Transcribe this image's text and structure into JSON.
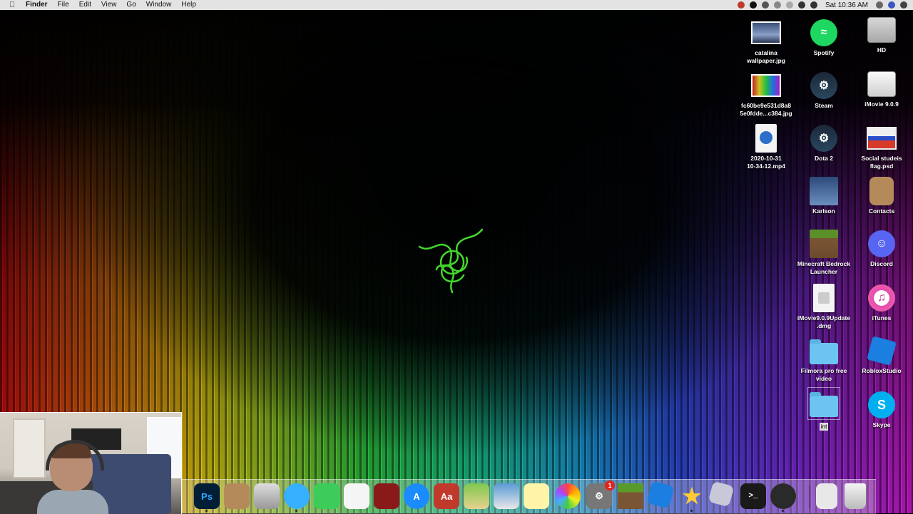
{
  "menubar": {
    "app_name": "Finder",
    "menus": [
      "File",
      "Edit",
      "View",
      "Go",
      "Window",
      "Help"
    ],
    "clock": "Sat 10:36 AM"
  },
  "desktop": {
    "icons": [
      {
        "label": "catalina\nwallpaper.jpg",
        "kind": "image-file"
      },
      {
        "label": "fc60be9e531d8a8\n5e0fdde...c384.jpg",
        "kind": "image-file"
      },
      {
        "label": "2020-10-31\n10-34-12.mp4",
        "kind": "video-file"
      },
      {
        "label": "Spotify",
        "kind": "app"
      },
      {
        "label": "Steam",
        "kind": "app"
      },
      {
        "label": "Dota 2",
        "kind": "app"
      },
      {
        "label": "Karlson",
        "kind": "app"
      },
      {
        "label": "Minecraft Bedrock\nLauncher",
        "kind": "app"
      },
      {
        "label": "iMovie9.0.9Update\n.dmg",
        "kind": "dmg-file"
      },
      {
        "label": "Filmora pro free\nvideo",
        "kind": "folder"
      },
      {
        "label": "",
        "kind": "folder"
      },
      {
        "label": "HD",
        "kind": "drive"
      },
      {
        "label": "iMovie 9.0.9",
        "kind": "drive"
      },
      {
        "label": "Social studeis\nflag.psd",
        "kind": "psd-file"
      },
      {
        "label": "Contacts",
        "kind": "app"
      },
      {
        "label": "Discord",
        "kind": "app"
      },
      {
        "label": "iTunes",
        "kind": "app"
      },
      {
        "label": "RobloxStudio",
        "kind": "app"
      },
      {
        "label": "Skype",
        "kind": "app"
      }
    ],
    "unnamed_folder_tag": "int"
  },
  "dock": {
    "items": [
      "Photoshop",
      "Contacts",
      "Calculator",
      "Messages",
      "FaceTime",
      "Reminders",
      "Photo Booth",
      "App Store",
      "Dictionary",
      "Maps",
      "Preview",
      "Notes",
      "Photos",
      "System Preferences",
      "Minecraft",
      "Roblox",
      "iMovie",
      "Roblox Player",
      "Terminal",
      "OBS",
      "Downloads",
      "Trash"
    ],
    "sysprefs_badge": "1",
    "photoshop_glyph": "Ps",
    "dictionary_glyph": "Aa",
    "terminal_glyph": ">_"
  },
  "colors": {
    "razer_green": "#44d62c",
    "menubar_bg": "#ececec"
  }
}
